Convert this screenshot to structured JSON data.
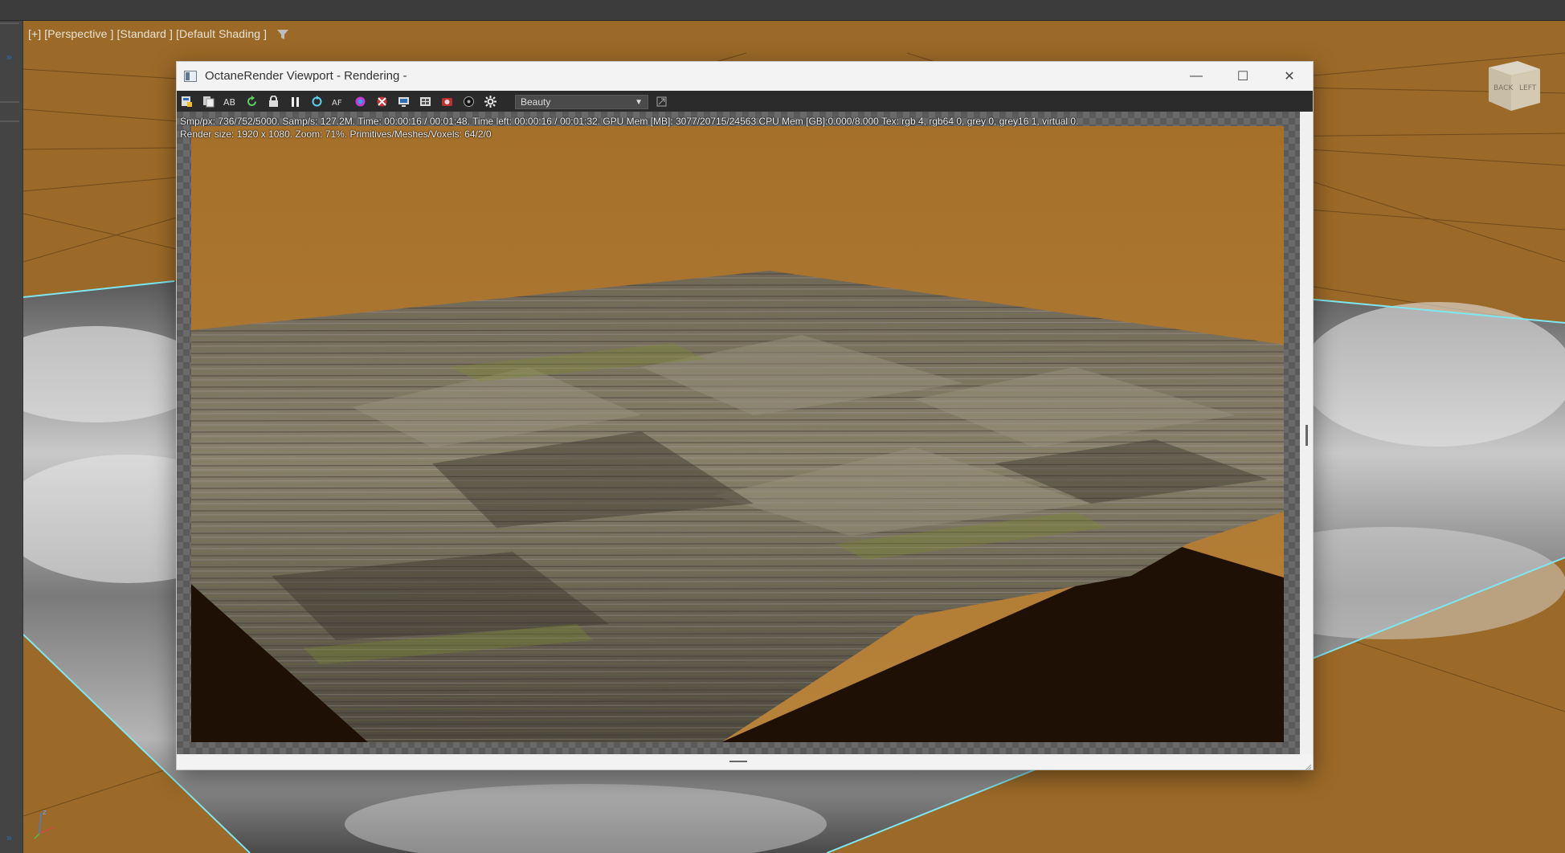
{
  "viewport": {
    "label": "[+] [Perspective ] [Standard ] [Default Shading ]",
    "viewcube": {
      "face_back": "BACK",
      "face_left": "LEFT"
    },
    "axis": {
      "z": "z",
      "x": "x"
    }
  },
  "octane_window": {
    "title": "OctaneRender Viewport - Rendering -",
    "controls": {
      "minimize": "—",
      "maximize": "☐",
      "close": "✕"
    },
    "toolbar": {
      "icons": [
        "save-render-icon",
        "copy-icon",
        "ab-compare-icon",
        "refresh-icon",
        "lock-icon",
        "pause-icon",
        "restart-icon",
        "af-icon",
        "color-picker-icon",
        "region-icon",
        "display-icon",
        "film-icon",
        "camera-icon",
        "tonemap-icon",
        "settings-icon"
      ],
      "pass_select": {
        "value": "Beauty"
      },
      "extra_icon": "detach-icon"
    },
    "stats": {
      "line1": "Smp/px: 736/752/5000.   Samp/s: 127.2M.   Time: 00:00:16 / 00:01:48.   Time left: 00:00:16 / 00:01:32.   GPU Mem [MB]: 3077/20715/24563   CPU Mem [GB]:0.000/8.000   Tex: rgb 4, rgb64 0, grey 0, grey16 1, virtual 0.",
      "line2": "Render size: 1920 x 1080.   Zoom: 71%.   Primitives/Meshes/Voxels: 64/2/0"
    }
  },
  "colors": {
    "viewport_bg": "#9c6a28",
    "render_sky": "#a9742b",
    "terrain_shadow": "#1e1004",
    "wire_highlight": "#7fe7f0"
  }
}
